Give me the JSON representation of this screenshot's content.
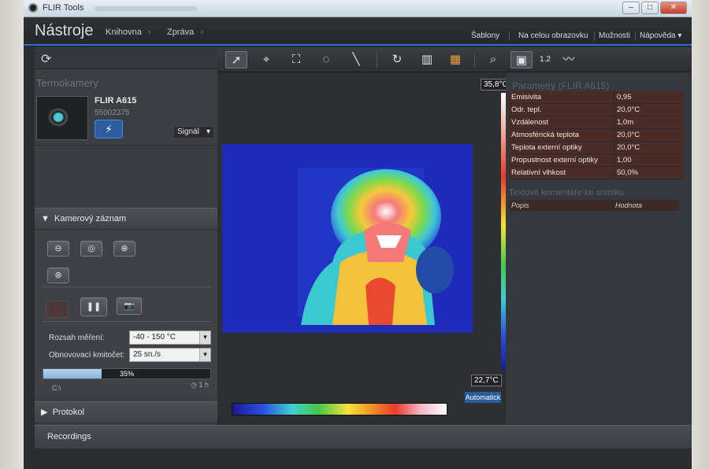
{
  "window": {
    "title": "FLIR Tools"
  },
  "menu": {
    "brand": "Nástroje",
    "nav": [
      "Knihovna",
      "Zpráva"
    ],
    "right": [
      "Šablony",
      "Na celou obrazovku",
      "Možnosti",
      "Nápověda ▾"
    ]
  },
  "cameras": {
    "heading": "Termokamery",
    "name": "FLIR A615",
    "serial": "55002375",
    "signal_label": "Signál"
  },
  "recording": {
    "title": "Kamerový záznam",
    "range_label": "Rozsah měření:",
    "range_value": "-40 - 150 °C",
    "rate_label": "Obnovovací kmitočet:",
    "rate_value": "25 sn./s",
    "progress_text": "35%",
    "progress_value": 0.35,
    "path": "C:\\",
    "duration": "1 h"
  },
  "protokol": {
    "title": "Protokol"
  },
  "recordings": {
    "title": "Recordings"
  },
  "image": {
    "max_temp": "35,8°C",
    "min_temp": "22,7°C",
    "auto_label": "Automatick"
  },
  "params": {
    "heading": "Parametry (FLIR A615)",
    "rows": [
      {
        "k": "Emisivita",
        "v": "0,95"
      },
      {
        "k": "Odr. tepl.",
        "v": "20,0°C"
      },
      {
        "k": "Vzdálenost",
        "v": "1,0m"
      },
      {
        "k": "Atmosférická teplota",
        "v": "20,0°C"
      },
      {
        "k": "Teplota externí optiky",
        "v": "20,0°C"
      },
      {
        "k": "Propustnost externí optiky",
        "v": "1,00"
      },
      {
        "k": "Relativní vlhkost",
        "v": "50,0%"
      }
    ]
  },
  "comments": {
    "heading": "Textové komentáře ke snímku",
    "col1": "Popis",
    "col2": "Hodnota"
  },
  "colors": {
    "accent": "#2a6bd1",
    "param_bg": "#4a2c26"
  }
}
